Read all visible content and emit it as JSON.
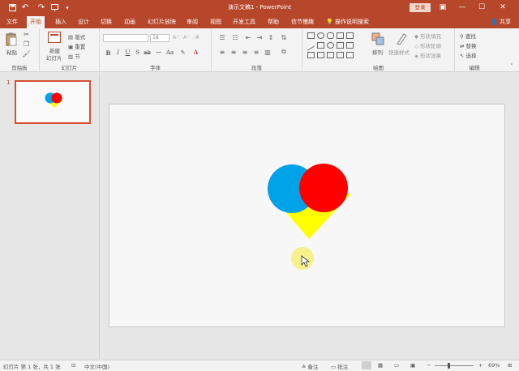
{
  "titlebar": {
    "title": "演示文稿1 - PowerPoint",
    "login": "登录",
    "quick_access": [
      "save-icon",
      "undo-icon",
      "redo-icon",
      "start-from-beginning-icon",
      "customize-icon"
    ]
  },
  "tabs": [
    {
      "label": "文件",
      "active": false
    },
    {
      "label": "开始",
      "active": true
    },
    {
      "label": "插入",
      "active": false
    },
    {
      "label": "设计",
      "active": false
    },
    {
      "label": "切换",
      "active": false
    },
    {
      "label": "动画",
      "active": false
    },
    {
      "label": "幻灯片放映",
      "active": false
    },
    {
      "label": "审阅",
      "active": false
    },
    {
      "label": "视图",
      "active": false
    },
    {
      "label": "开发工具",
      "active": false
    },
    {
      "label": "帮助",
      "active": false
    },
    {
      "label": "信节慢趣",
      "active": false
    }
  ],
  "tell_me": "操作说明搜索",
  "share": "共享",
  "ribbon": {
    "clipboard": {
      "paste": "粘贴",
      "label": "剪贴板"
    },
    "slides": {
      "new_slide": "新建",
      "new_slide2": "幻灯片",
      "layout": "版式",
      "reset": "重置",
      "section": "节",
      "label": "幻灯片"
    },
    "font": {
      "size": "18",
      "label": "字体"
    },
    "paragraph": {
      "label": "段落"
    },
    "drawing": {
      "arrange": "排列",
      "quick_styles": "快速样式",
      "fill": "形状填充",
      "outline": "形状轮廓",
      "effects": "形状效果",
      "label": "绘图"
    },
    "editing": {
      "find": "查找",
      "replace": "替换",
      "select": "选择",
      "label": "编辑"
    }
  },
  "thumbnail": {
    "number": "1"
  },
  "colors": {
    "accent": "#b7472a",
    "blue": "#00a2e8",
    "red": "#ff0000",
    "yellow": "#ffff00"
  },
  "statusbar": {
    "slide_info": "幻灯片 第 1 张，共 1 张",
    "language": "中文(中国)",
    "notes": "备注",
    "comments": "批注",
    "zoom": "69%"
  }
}
